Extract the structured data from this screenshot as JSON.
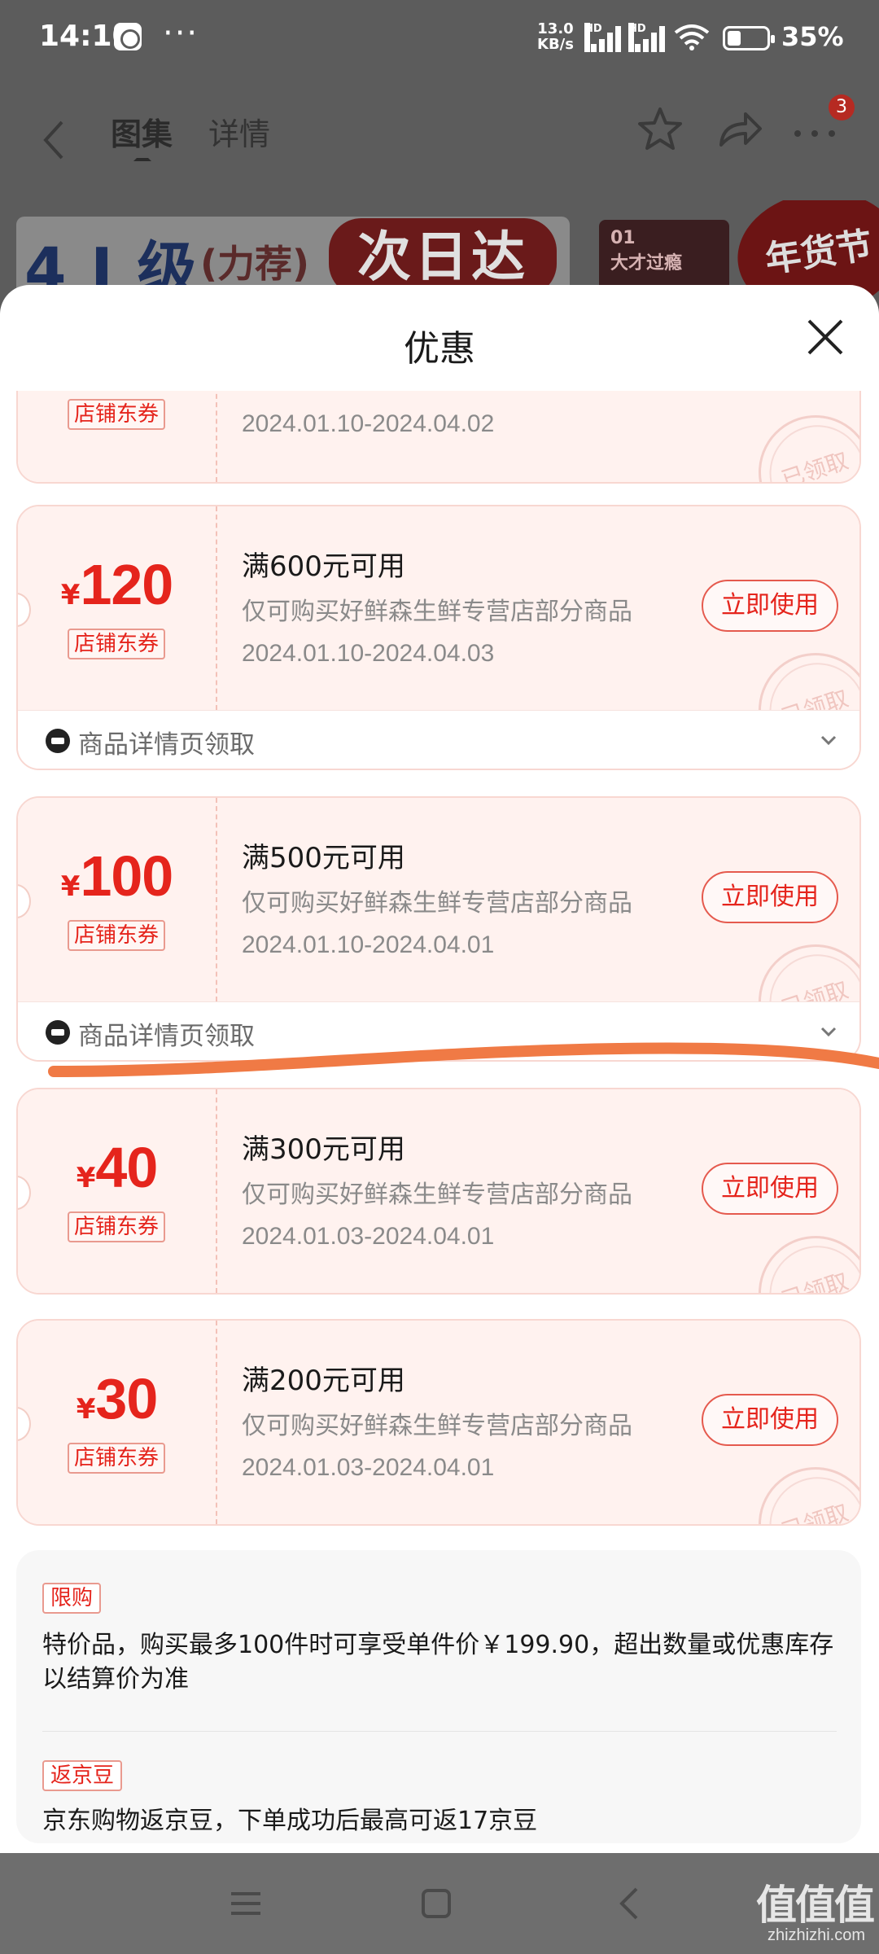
{
  "status_bar": {
    "time": "14:10",
    "dots": "···",
    "net_speed_value": "13.0",
    "net_speed_unit": "KB/s",
    "hd1": "HD",
    "hd2": "HD",
    "battery_percent": "35%"
  },
  "nav": {
    "tab_gallery": "图集",
    "tab_details": "详情",
    "more_badge": "3"
  },
  "banner": {
    "main_text": "4 J 级",
    "sub_text": "(力荐)",
    "pill_text": "次日达",
    "right_title": "01",
    "right_text": "大才过瘾",
    "festival_text": "年货节"
  },
  "sheet": {
    "title": "优惠"
  },
  "coupons": [
    {
      "amount": "",
      "currency": "",
      "tag": "店铺东券",
      "condition": "",
      "scope": "",
      "date": "2024.01.10-2024.04.02",
      "button": "",
      "stamp": "已领取",
      "footer": ""
    },
    {
      "amount": "120",
      "currency": "¥",
      "tag": "店铺东券",
      "condition": "满600元可用",
      "scope": "仅可购买好鲜森生鲜专营店部分商品",
      "date": "2024.01.10-2024.04.03",
      "button": "立即使用",
      "stamp": "已领取",
      "footer": "商品详情页领取"
    },
    {
      "amount": "100",
      "currency": "¥",
      "tag": "店铺东券",
      "condition": "满500元可用",
      "scope": "仅可购买好鲜森生鲜专营店部分商品",
      "date": "2024.01.10-2024.04.01",
      "button": "立即使用",
      "stamp": "已领取",
      "footer": "商品详情页领取"
    },
    {
      "amount": "40",
      "currency": "¥",
      "tag": "店铺东券",
      "condition": "满300元可用",
      "scope": "仅可购买好鲜森生鲜专营店部分商品",
      "date": "2024.01.03-2024.04.01",
      "button": "立即使用",
      "stamp": "已领取",
      "footer": ""
    },
    {
      "amount": "30",
      "currency": "¥",
      "tag": "店铺东券",
      "condition": "满200元可用",
      "scope": "仅可购买好鲜森生鲜专营店部分商品",
      "date": "2024.01.03-2024.04.01",
      "button": "立即使用",
      "stamp": "已领取",
      "footer": ""
    }
  ],
  "info": {
    "limit_tag": "限购",
    "limit_text": "特价品，购买最多100件时可享受单件价￥199.90，超出数量或优惠库存以结算价为准",
    "bean_tag": "返京豆",
    "bean_text": "京东购物返京豆，下单成功后最高可返17京豆"
  },
  "watermark": {
    "main": "值值值",
    "sub": "zhizhizhi.com"
  },
  "colors": {
    "accent_red": "#e5241c",
    "coupon_bg": "#fff2ef",
    "annotation_orange": "#f07a45"
  }
}
